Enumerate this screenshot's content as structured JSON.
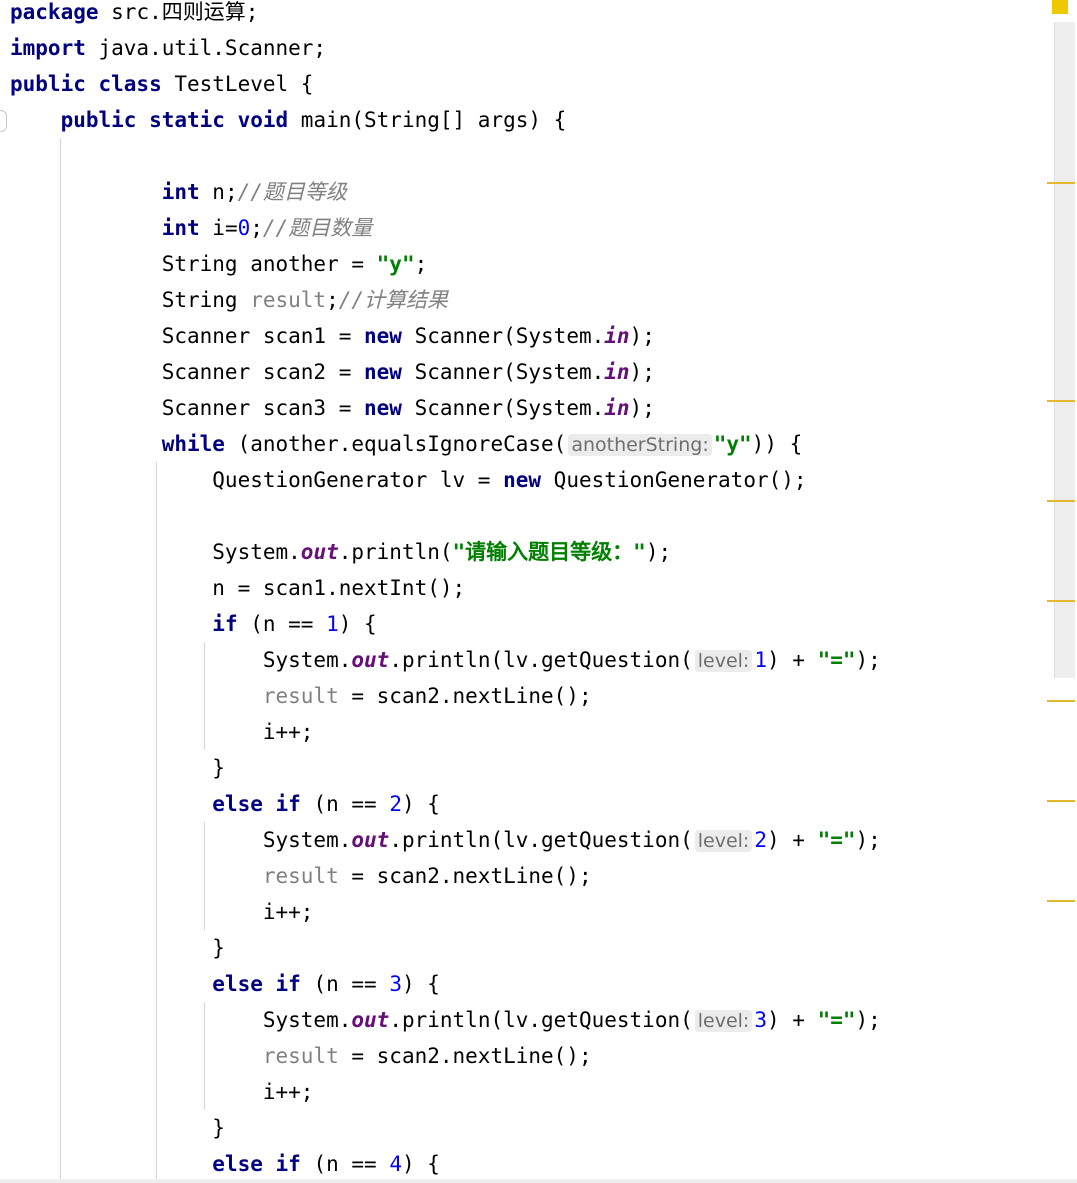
{
  "editor": {
    "lines": [
      [
        {
          "t": "package",
          "c": "kw"
        },
        {
          "t": " src.四则运算;"
        }
      ],
      [
        {
          "t": "import",
          "c": "kw"
        },
        {
          "t": " java.util.Scanner;"
        }
      ],
      [
        {
          "t": "public class",
          "c": "kw"
        },
        {
          "t": " TestLevel {"
        }
      ],
      [
        {
          "t": "    "
        },
        {
          "t": "public static void",
          "c": "kw"
        },
        {
          "t": " main(String[] args) {"
        }
      ],
      [],
      [
        {
          "t": "            "
        },
        {
          "t": "int",
          "c": "kw"
        },
        {
          "t": " n;"
        },
        {
          "t": "//题目等级",
          "c": "comment"
        }
      ],
      [
        {
          "t": "            "
        },
        {
          "t": "int",
          "c": "kw"
        },
        {
          "t": " i="
        },
        {
          "t": "0",
          "c": "num"
        },
        {
          "t": ";"
        },
        {
          "t": "//题目数量",
          "c": "comment"
        }
      ],
      [
        {
          "t": "            String another = "
        },
        {
          "t": "\"y\"",
          "c": "str"
        },
        {
          "t": ";"
        }
      ],
      [
        {
          "t": "            String "
        },
        {
          "t": "result",
          "c": "unused"
        },
        {
          "t": ";"
        },
        {
          "t": "//计算结果",
          "c": "comment"
        }
      ],
      [
        {
          "t": "            Scanner scan1 = "
        },
        {
          "t": "new",
          "c": "kw"
        },
        {
          "t": " Scanner(System."
        },
        {
          "t": "in",
          "c": "field"
        },
        {
          "t": ");"
        }
      ],
      [
        {
          "t": "            Scanner scan2 = "
        },
        {
          "t": "new",
          "c": "kw"
        },
        {
          "t": " Scanner(System."
        },
        {
          "t": "in",
          "c": "field"
        },
        {
          "t": ");"
        }
      ],
      [
        {
          "t": "            Scanner scan3 = "
        },
        {
          "t": "new",
          "c": "kw"
        },
        {
          "t": " Scanner(System."
        },
        {
          "t": "in",
          "c": "field"
        },
        {
          "t": ");"
        }
      ],
      [
        {
          "t": "            "
        },
        {
          "t": "while",
          "c": "kw"
        },
        {
          "t": " (another.equalsIgnoreCase("
        },
        {
          "t": "anotherString:",
          "c": "hint"
        },
        {
          "t": "\"y\"",
          "c": "str"
        },
        {
          "t": ")) {"
        }
      ],
      [
        {
          "t": "                QuestionGenerator lv = "
        },
        {
          "t": "new",
          "c": "kw"
        },
        {
          "t": " QuestionGenerator();"
        }
      ],
      [],
      [
        {
          "t": "                System."
        },
        {
          "t": "out",
          "c": "field"
        },
        {
          "t": ".println("
        },
        {
          "t": "\"请输入题目等级：\"",
          "c": "str"
        },
        {
          "t": ");"
        }
      ],
      [
        {
          "t": "                n = scan1.nextInt();"
        }
      ],
      [
        {
          "t": "                "
        },
        {
          "t": "if",
          "c": "kw"
        },
        {
          "t": " (n == "
        },
        {
          "t": "1",
          "c": "num"
        },
        {
          "t": ") {"
        }
      ],
      [
        {
          "t": "                    System."
        },
        {
          "t": "out",
          "c": "field"
        },
        {
          "t": ".println(lv.getQuestion("
        },
        {
          "t": "level:",
          "c": "hint"
        },
        {
          "t": "1",
          "c": "num"
        },
        {
          "t": ") + "
        },
        {
          "t": "\"=\"",
          "c": "str"
        },
        {
          "t": ");"
        }
      ],
      [
        {
          "t": "                    "
        },
        {
          "t": "result",
          "c": "unused"
        },
        {
          "t": " = scan2.nextLine();"
        }
      ],
      [
        {
          "t": "                    i++;"
        }
      ],
      [
        {
          "t": "                }"
        }
      ],
      [
        {
          "t": "                "
        },
        {
          "t": "else if",
          "c": "kw"
        },
        {
          "t": " (n == "
        },
        {
          "t": "2",
          "c": "num"
        },
        {
          "t": ") {"
        }
      ],
      [
        {
          "t": "                    System."
        },
        {
          "t": "out",
          "c": "field"
        },
        {
          "t": ".println(lv.getQuestion("
        },
        {
          "t": "level:",
          "c": "hint"
        },
        {
          "t": "2",
          "c": "num"
        },
        {
          "t": ") + "
        },
        {
          "t": "\"=\"",
          "c": "str"
        },
        {
          "t": ");"
        }
      ],
      [
        {
          "t": "                    "
        },
        {
          "t": "result",
          "c": "unused"
        },
        {
          "t": " = scan2.nextLine();"
        }
      ],
      [
        {
          "t": "                    i++;"
        }
      ],
      [
        {
          "t": "                }"
        }
      ],
      [
        {
          "t": "                "
        },
        {
          "t": "else if",
          "c": "kw"
        },
        {
          "t": " (n == "
        },
        {
          "t": "3",
          "c": "num"
        },
        {
          "t": ") {"
        }
      ],
      [
        {
          "t": "                    System."
        },
        {
          "t": "out",
          "c": "field"
        },
        {
          "t": ".println(lv.getQuestion("
        },
        {
          "t": "level:",
          "c": "hint"
        },
        {
          "t": "3",
          "c": "num"
        },
        {
          "t": ") + "
        },
        {
          "t": "\"=\"",
          "c": "str"
        },
        {
          "t": ");"
        }
      ],
      [
        {
          "t": "                    "
        },
        {
          "t": "result",
          "c": "unused"
        },
        {
          "t": " = scan2.nextLine();"
        }
      ],
      [
        {
          "t": "                    i++;"
        }
      ],
      [
        {
          "t": "                }"
        }
      ],
      [
        {
          "t": "                "
        },
        {
          "t": "else if",
          "c": "kw"
        },
        {
          "t": " (n == "
        },
        {
          "t": "4",
          "c": "num"
        },
        {
          "t": ") {"
        }
      ]
    ]
  },
  "colors": {
    "keyword": "#000080",
    "string": "#008000",
    "number": "#0000ff",
    "comment": "#808080",
    "static_field": "#660e7a",
    "inlay_hint_bg": "#ececec",
    "scrollbar_marker": "#e3b82c",
    "status_indicator": "#f0c800"
  },
  "scrollbar": {
    "status_icon": "warning-status-icon",
    "marker_count": 7
  }
}
